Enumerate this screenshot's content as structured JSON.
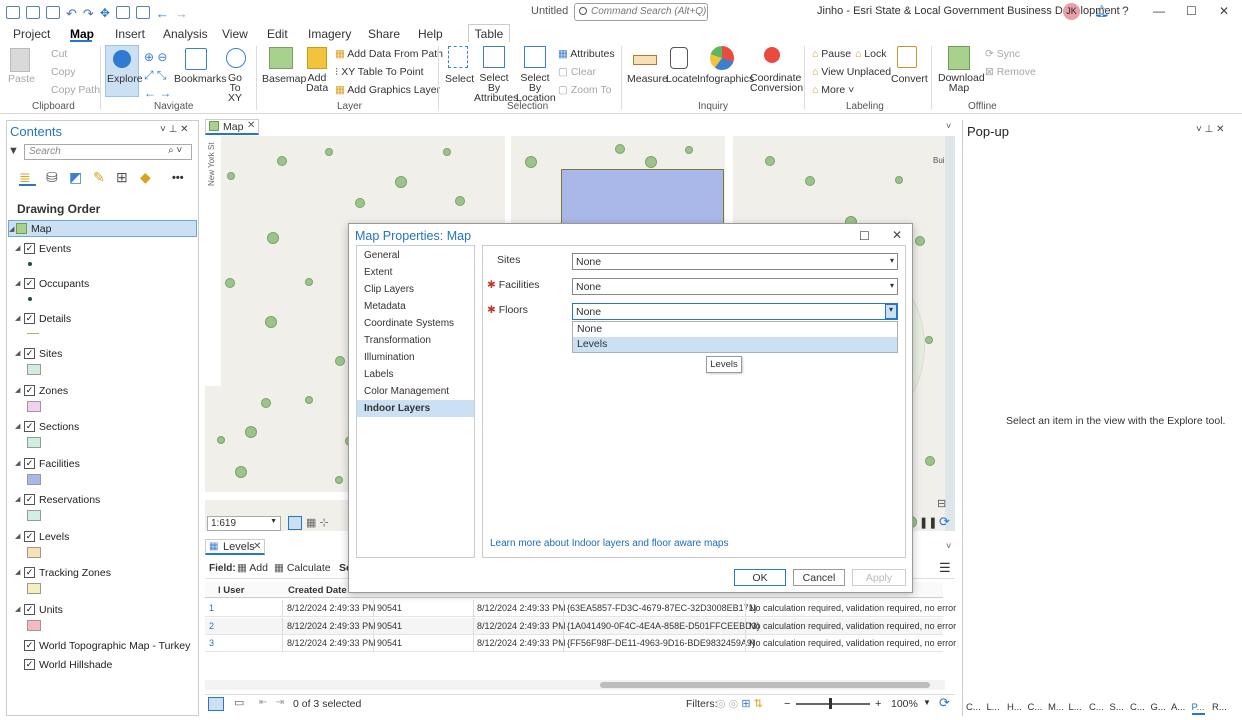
{
  "title_bar": {
    "doc": "Untitled",
    "search_placeholder": "Command Search (Alt+Q)",
    "account": "Jinho - Esri State & Local Government Business Development",
    "initials": "JK",
    "help": "?",
    "minimize": "—",
    "maximize": "☐",
    "close": "✕"
  },
  "menu": {
    "project": "Project",
    "map": "Map",
    "insert": "Insert",
    "analysis": "Analysis",
    "view": "View",
    "edit": "Edit",
    "imagery": "Imagery",
    "share": "Share",
    "help": "Help",
    "table": "Table"
  },
  "ribbon": {
    "paste": "Paste",
    "cut": "Cut",
    "copy": "Copy",
    "copy_path": "Copy Path",
    "clipboard": "Clipboard",
    "explore": "Explore",
    "bookmarks": "Bookmarks",
    "go_to_xy": "Go To XY",
    "navigate": "Navigate",
    "basemap": "Basemap",
    "add_data": "Add Data",
    "add_from_path": "Add Data From Path",
    "xy_table": "XY Table To Point",
    "add_graphics": "Add Graphics Layer",
    "layer": "Layer",
    "select": "Select",
    "select_by_attr": "Select By Attributes",
    "select_by_loc": "Select By Location",
    "attributes": "Attributes",
    "clear": "Clear",
    "zoom_to": "Zoom To",
    "selection": "Selection",
    "measure": "Measure",
    "locate": "Locate",
    "infographics": "Infographics",
    "coord_conv": "Coordinate Conversion",
    "inquiry": "Inquiry",
    "pause": "Pause",
    "lock": "Lock",
    "view_unplaced": "View Unplaced",
    "more": "More",
    "convert": "Convert",
    "labeling": "Labeling",
    "download_map": "Download Map",
    "sync": "Sync",
    "remove": "Remove",
    "offline": "Offline"
  },
  "contents": {
    "title": "Contents",
    "search_placeholder": "Search",
    "drawing_order": "Drawing Order",
    "more": "•••",
    "layers": [
      {
        "name": "Map"
      },
      {
        "name": "Events"
      },
      {
        "name": "Occupants"
      },
      {
        "name": "Details"
      },
      {
        "name": "Sites"
      },
      {
        "name": "Zones"
      },
      {
        "name": "Sections"
      },
      {
        "name": "Facilities"
      },
      {
        "name": "Reservations"
      },
      {
        "name": "Levels"
      },
      {
        "name": "Tracking Zones"
      },
      {
        "name": "Units"
      },
      {
        "name": "World Topographic Map - Turkey"
      },
      {
        "name": "World Hillshade"
      }
    ],
    "colors": {
      "sites": "#cfeedd",
      "zones": "#f6cff0",
      "sections": "#cfeedd",
      "facilities": "#a9b8ec",
      "reservations": "#cff0e2",
      "levels": "#f7e2b6",
      "tracking": "#f5f0b9",
      "units": "#f7b8c0"
    }
  },
  "map": {
    "tab": "Map",
    "scale": "1:619",
    "street_label": "New York St",
    "building_label": "Buildi"
  },
  "dialog": {
    "title": "Map Properties: Map",
    "nav": [
      "General",
      "Extent",
      "Clip Layers",
      "Metadata",
      "Coordinate Systems",
      "Transformation",
      "Illumination",
      "Labels",
      "Color Management",
      "Indoor Layers"
    ],
    "sites_label": "Sites",
    "sites_value": "None",
    "facilities_label": "Facilities",
    "facilities_value": "None",
    "floors_label": "Floors",
    "floors_value": "None",
    "dropdown": [
      "None",
      "Levels"
    ],
    "tooltip": "Levels",
    "learn_more": "Learn more about Indoor layers and floor aware maps",
    "ok": "OK",
    "cancel": "Cancel",
    "apply": "Apply"
  },
  "table": {
    "tab": "Levels",
    "field": "Field:",
    "add": "Add",
    "calculate": "Calculate",
    "se": "Se",
    "cols": [
      "l User",
      "Created Date"
    ],
    "rows": [
      {
        "n": "1",
        "date": "8/12/2024 2:49:33 PM",
        "num": "90541",
        "date2": "8/12/2024 2:49:33 PM",
        "guid": "{63EA5857-FD3C-4679-87EC-32D3008EB171}",
        "status": "No calculation required, validation required, no error"
      },
      {
        "n": "2",
        "date": "8/12/2024 2:49:33 PM",
        "num": "90541",
        "date2": "8/12/2024 2:49:33 PM",
        "guid": "{1A041490-0F4C-4E4A-858E-D501FFCEEBD3}",
        "status": "No calculation required, validation required, no error"
      },
      {
        "n": "3",
        "date": "8/12/2024 2:49:33 PM",
        "num": "90541",
        "date2": "8/12/2024 2:49:33 PM",
        "guid": "{FF56F98F-DE11-4963-9D16-BDE9832459A9}",
        "status": "No calculation required, validation required, no error"
      }
    ],
    "selected": "0 of 3 selected",
    "filters": "Filters:",
    "zoom": "100%"
  },
  "popup": {
    "title": "Pop-up",
    "msg": "Select an item in the view with the Explore tool.",
    "tabs": [
      "C...",
      "L...",
      "H...",
      "C...",
      "M...",
      "L...",
      "C...",
      "S...",
      "C...",
      "G...",
      "A...",
      "P...",
      "R..."
    ]
  }
}
